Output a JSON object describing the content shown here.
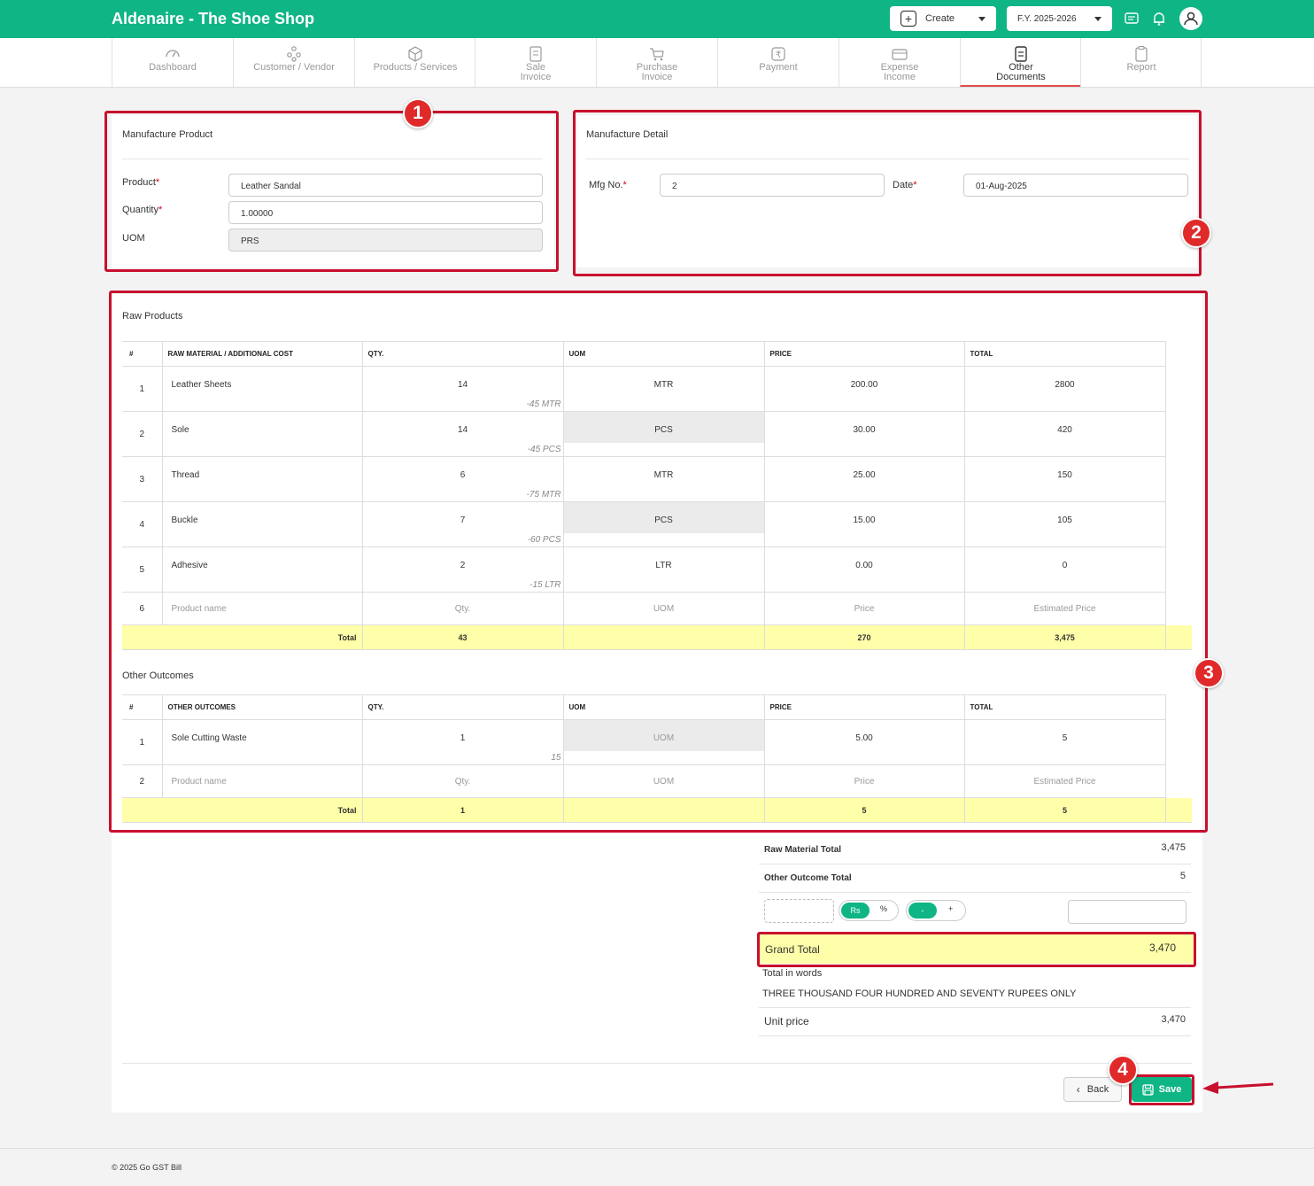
{
  "app": {
    "title": "Aldenaire - The Shoe Shop"
  },
  "header": {
    "create_label": "Create",
    "fy_label": "F.Y. 2025-2026",
    "icons": [
      "message-icon",
      "bell-icon",
      "user-icon"
    ]
  },
  "nav": [
    {
      "line1": "Dashboard",
      "line2": "",
      "icon": "gauge-icon"
    },
    {
      "line1": "Customer / Vendor",
      "line2": "",
      "icon": "users-icon"
    },
    {
      "line1": "Products / Services",
      "line2": "",
      "icon": "box-icon"
    },
    {
      "line1": "Sale",
      "line2": "Invoice",
      "icon": "invoice-icon"
    },
    {
      "line1": "Purchase",
      "line2": "Invoice",
      "icon": "cart-icon"
    },
    {
      "line1": "Payment",
      "line2": "",
      "icon": "rupee-icon"
    },
    {
      "line1": "Expense",
      "line2": "Income",
      "icon": "wallet-icon"
    },
    {
      "line1": "Other",
      "line2": "Documents",
      "icon": "document-icon",
      "active": true
    },
    {
      "line1": "Report",
      "line2": "",
      "icon": "report-icon"
    }
  ],
  "manufacture_product": {
    "title": "Manufacture Product",
    "product_label": "Product",
    "product_value": "Leather Sandal",
    "quantity_label": "Quantity",
    "quantity_value": "1.00000",
    "uom_label": "UOM",
    "uom_value": "PRS"
  },
  "manufacture_detail": {
    "title": "Manufacture Detail",
    "mfg_label": "Mfg No.",
    "mfg_value": "2",
    "date_label": "Date",
    "date_value": "01-Aug-2025"
  },
  "raw_products": {
    "title": "Raw Products",
    "headers": [
      "#",
      "RAW MATERIAL / ADDITIONAL COST",
      "QTY.",
      "UOM",
      "PRICE",
      "TOTAL"
    ],
    "rows": [
      {
        "n": "1",
        "name": "Leather Sheets",
        "qty": "14",
        "stock": "-45 MTR",
        "uom": "MTR",
        "uom_shaded": false,
        "price": "200.00",
        "total": "2800"
      },
      {
        "n": "2",
        "name": "Sole",
        "qty": "14",
        "stock": "-45 PCS",
        "uom": "PCS",
        "uom_shaded": true,
        "price": "30.00",
        "total": "420"
      },
      {
        "n": "3",
        "name": "Thread",
        "qty": "6",
        "stock": "-75 MTR",
        "uom": "MTR",
        "uom_shaded": false,
        "price": "25.00",
        "total": "150"
      },
      {
        "n": "4",
        "name": "Buckle",
        "qty": "7",
        "stock": "-60 PCS",
        "uom": "PCS",
        "uom_shaded": true,
        "price": "15.00",
        "total": "105"
      },
      {
        "n": "5",
        "name": "Adhesive",
        "qty": "2",
        "stock": "-15 LTR",
        "uom": "LTR",
        "uom_shaded": false,
        "price": "0.00",
        "total": "0"
      }
    ],
    "placeholder": {
      "n": "6",
      "name": "Product name",
      "qty": "Qty.",
      "uom": "UOM",
      "price": "Price",
      "total": "Estimated Price"
    },
    "totals": {
      "label": "Total",
      "qty": "43",
      "price": "270",
      "total": "3,475"
    }
  },
  "other_outcomes": {
    "title": "Other Outcomes",
    "headers": [
      "#",
      "OTHER OUTCOMES",
      "QTY.",
      "UOM",
      "PRICE",
      "TOTAL"
    ],
    "rows": [
      {
        "n": "1",
        "name": "Sole Cutting Waste",
        "qty": "1",
        "stock": "15",
        "uom": "UOM",
        "uom_shaded": true,
        "price": "5.00",
        "total": "5"
      }
    ],
    "placeholder": {
      "n": "2",
      "name": "Product name",
      "qty": "Qty.",
      "uom": "UOM",
      "price": "Price",
      "total": "Estimated Price"
    },
    "totals": {
      "label": "Total",
      "qty": "1",
      "price": "5",
      "total": "5"
    }
  },
  "summary": {
    "raw_total_label": "Raw Material Total",
    "raw_total_value": "3,475",
    "other_total_label": "Other Outcome Total",
    "other_total_value": "5",
    "rs_label": "Rs",
    "pct_label": "%",
    "minus_label": "-",
    "plus_label": "+",
    "grand_total_label": "Grand Total",
    "grand_total_value": "3,470",
    "words_label": "Total in words",
    "words_value": "THREE THOUSAND FOUR HUNDRED AND SEVENTY RUPEES ONLY",
    "unit_price_label": "Unit price",
    "unit_price_value": "3,470"
  },
  "actions": {
    "back_label": "Back",
    "save_label": "Save"
  },
  "annotations": {
    "badge1": "1",
    "badge2": "2",
    "badge3": "3",
    "badge4": "4",
    "color": "#c8102e"
  },
  "footer": {
    "text": "© 2025 Go GST Bill"
  }
}
